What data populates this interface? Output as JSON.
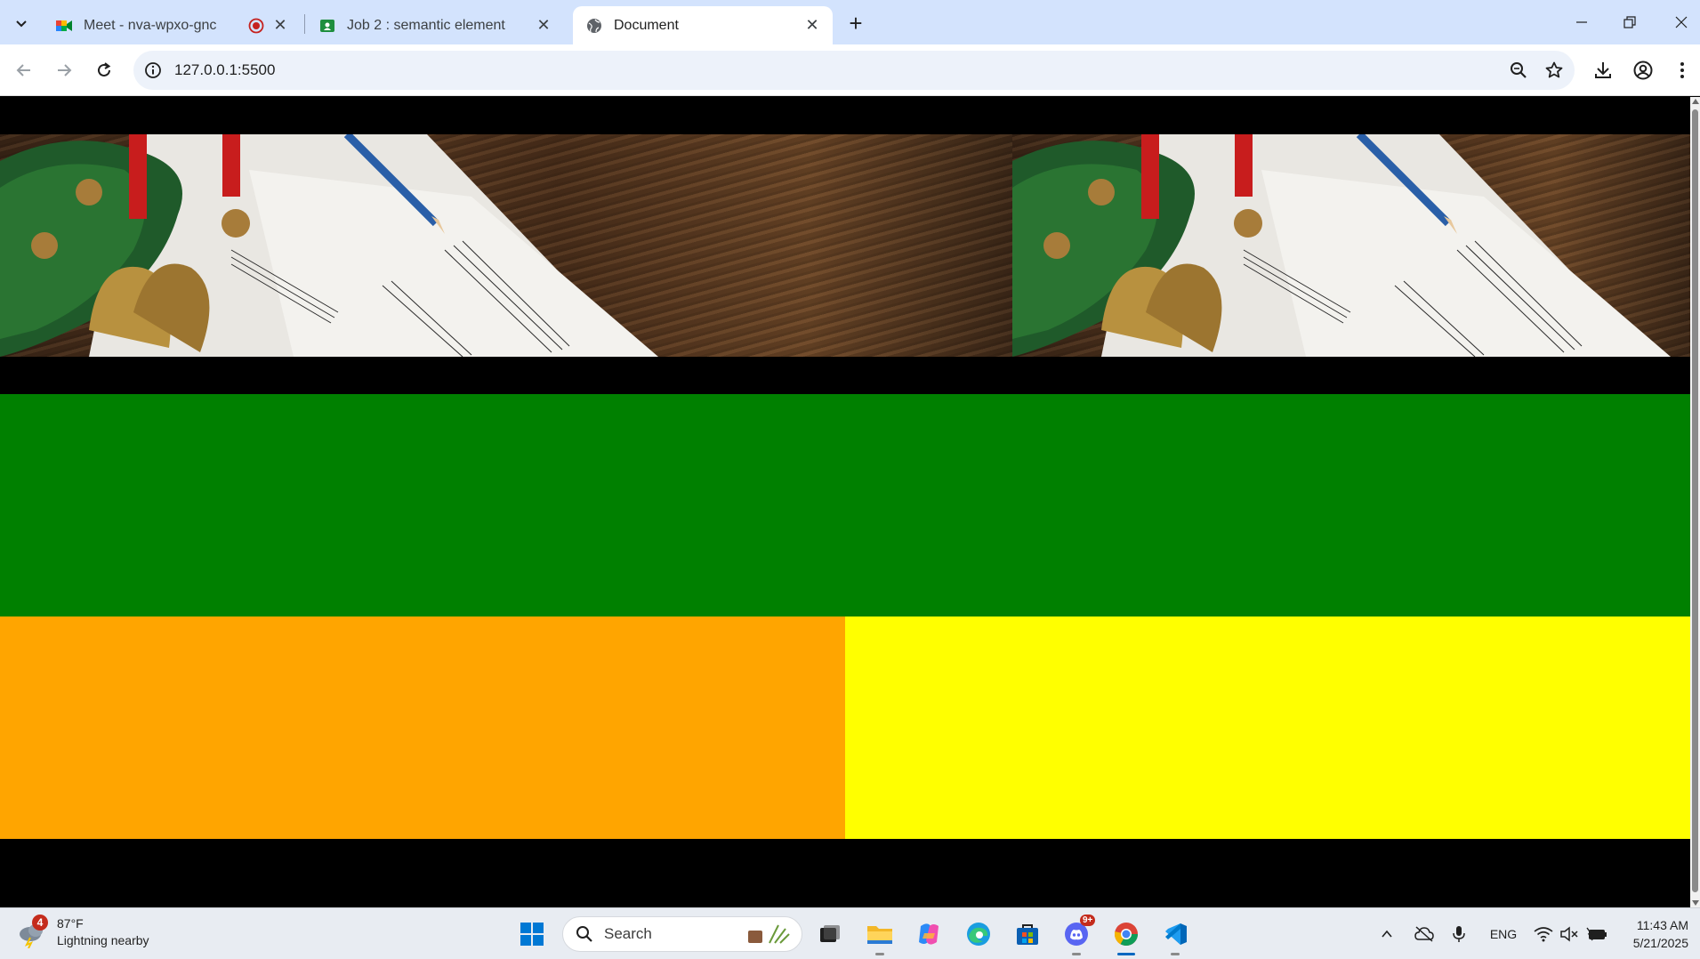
{
  "browser": {
    "tabs": [
      {
        "title": "Meet - nva-wpxo-gnc",
        "icon": "google-meet-icon",
        "recording": true
      },
      {
        "title": "Job 2 : semantic element",
        "icon": "google-classroom-icon"
      },
      {
        "title": "Document",
        "icon": "globe-icon",
        "active": true
      }
    ],
    "url": "127.0.0.1:5500"
  },
  "page": {
    "sections": [
      {
        "name": "header-banner",
        "color": "#000000"
      },
      {
        "name": "green-section",
        "color": "#008000"
      },
      {
        "name": "orange-section",
        "color": "#ffa500"
      },
      {
        "name": "yellow-section",
        "color": "#ffff00"
      },
      {
        "name": "footer",
        "color": "#000000"
      }
    ],
    "banner_image": "christmas-sheet-music-wreath-bells-photo"
  },
  "taskbar": {
    "weather": {
      "temp": "87°F",
      "condition": "Lightning nearby",
      "badge": "4"
    },
    "search_placeholder": "Search",
    "discord_badge": "9+",
    "language": "ENG",
    "time": "11:43 AM",
    "date": "5/21/2025"
  },
  "colors": {
    "tabbar_bg": "#d3e3fd",
    "omnibox_bg": "#edf2fa",
    "green": "#008000",
    "orange": "#ffa500",
    "yellow": "#ffff00"
  }
}
